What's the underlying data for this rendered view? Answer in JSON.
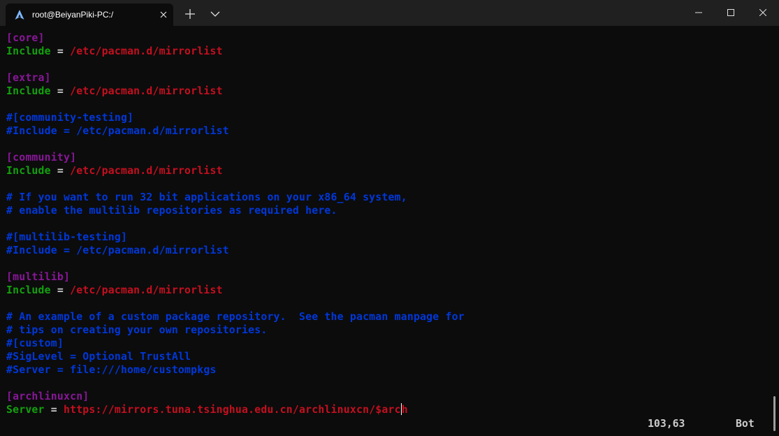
{
  "window": {
    "tab_title": "root@BeiyanPiki-PC:/",
    "icons": {
      "app": "arch-linux-icon",
      "close_tab": "close-icon",
      "new_tab": "plus-icon",
      "dropdown": "chevron-down-icon",
      "minimize": "minimize-icon",
      "maximize": "maximize-icon",
      "close_window": "close-icon"
    }
  },
  "colors": {
    "section": "#881798",
    "key": "#13a10e",
    "value": "#c50f1f",
    "comment": "#0037da",
    "text": "#cccccc",
    "background": "#0c0c0c"
  },
  "lines": [
    {
      "section": "[core]"
    },
    {
      "key": "Include",
      "op": " = ",
      "value": "/etc/pacman.d/mirrorlist"
    },
    {},
    {
      "section": "[extra]"
    },
    {
      "key": "Include",
      "op": " = ",
      "value": "/etc/pacman.d/mirrorlist"
    },
    {},
    {
      "comment": "#[community-testing]"
    },
    {
      "comment": "#Include = /etc/pacman.d/mirrorlist"
    },
    {},
    {
      "section": "[community]"
    },
    {
      "key": "Include",
      "op": " = ",
      "value": "/etc/pacman.d/mirrorlist"
    },
    {},
    {
      "comment": "# If you want to run 32 bit applications on your x86_64 system,"
    },
    {
      "comment": "# enable the multilib repositories as required here."
    },
    {},
    {
      "comment": "#[multilib-testing]"
    },
    {
      "comment": "#Include = /etc/pacman.d/mirrorlist"
    },
    {},
    {
      "section": "[multilib]"
    },
    {
      "key": "Include",
      "op": " = ",
      "value": "/etc/pacman.d/mirrorlist"
    },
    {},
    {
      "comment": "# An example of a custom package repository.  See the pacman manpage for"
    },
    {
      "comment": "# tips on creating your own repositories."
    },
    {
      "comment": "#[custom]"
    },
    {
      "comment": "#SigLevel = Optional TrustAll"
    },
    {
      "comment": "#Server = file:///home/custompkgs"
    },
    {},
    {
      "section": "[archlinuxcn]"
    },
    {
      "key": "Server",
      "op": " = ",
      "value": "https://mirrors.tuna.tsinghua.edu.cn/archlinuxcn/$arc",
      "value_after_cursor": "h"
    }
  ],
  "status": {
    "position": "103,63",
    "scroll": "Bot"
  }
}
